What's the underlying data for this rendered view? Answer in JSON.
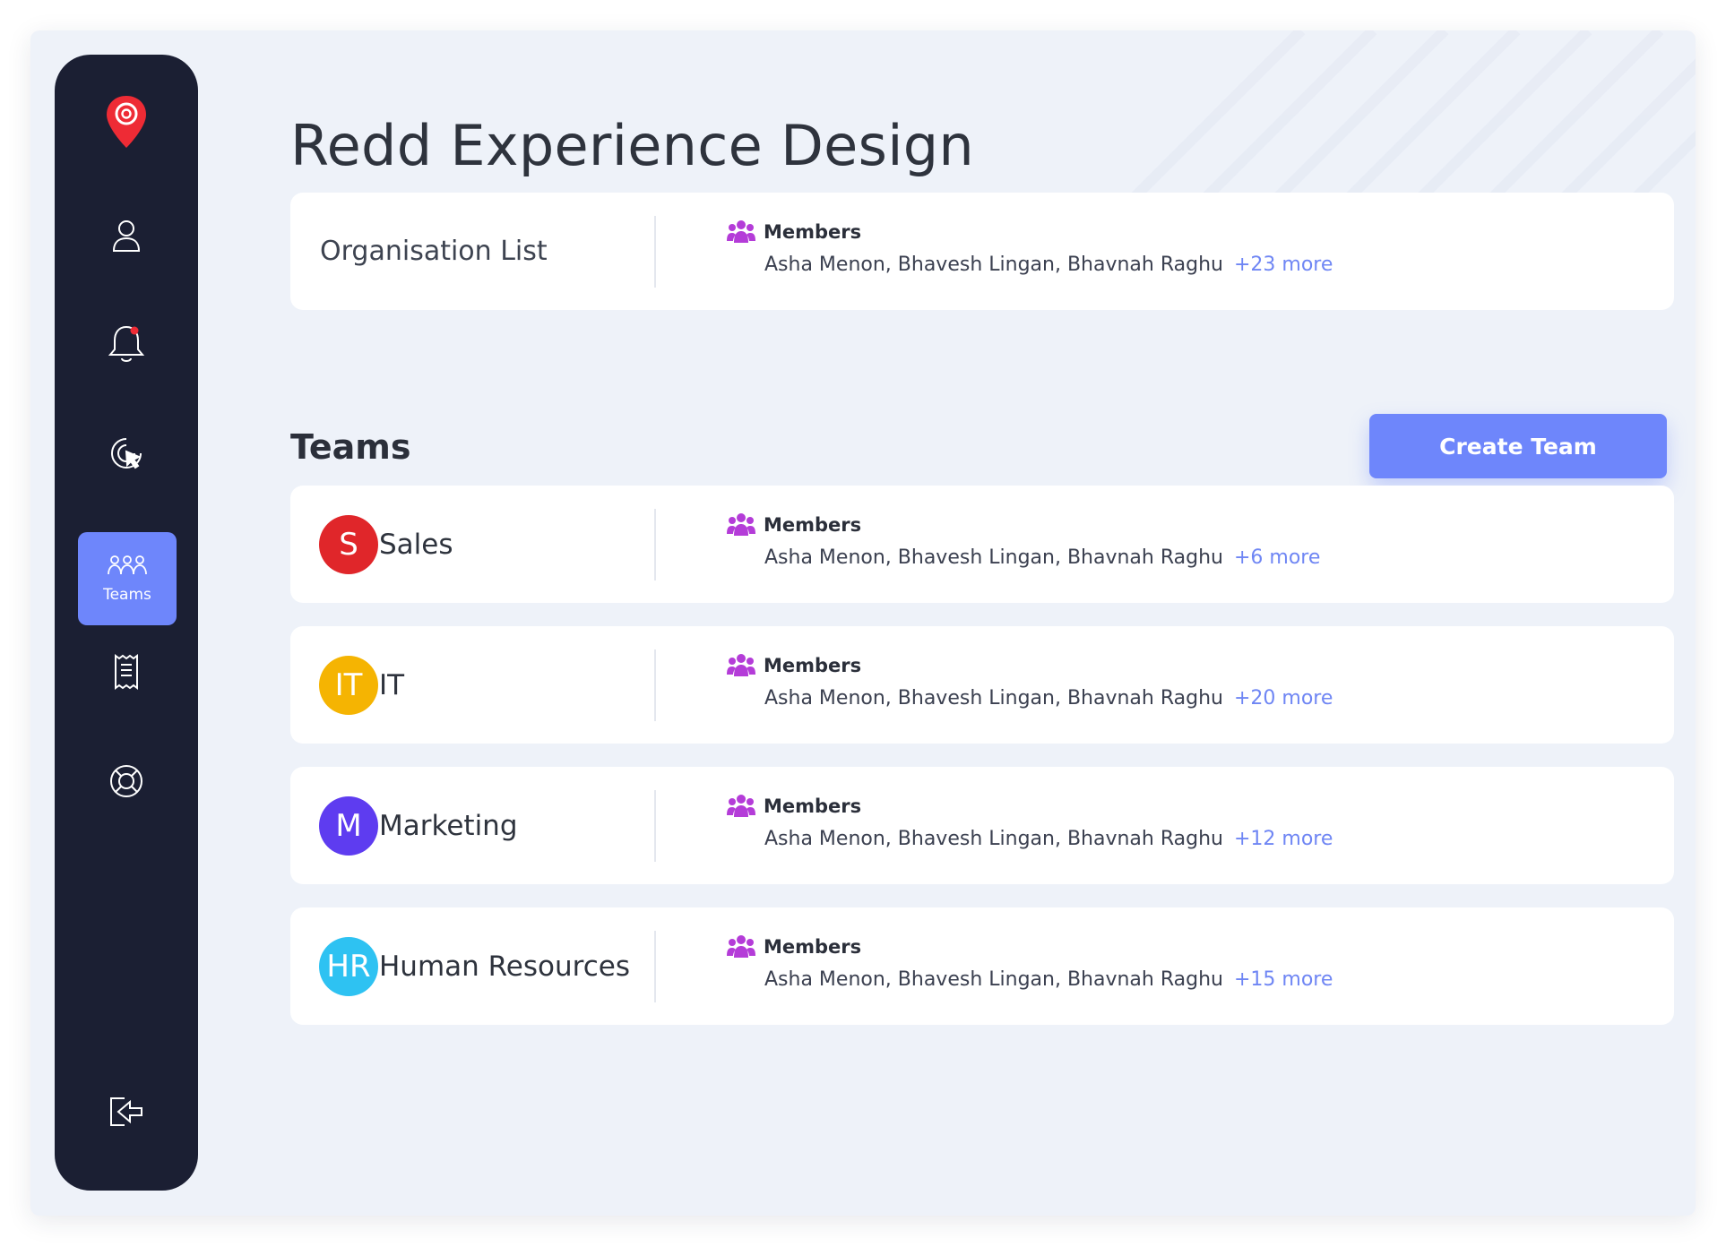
{
  "app": {
    "title": "Redd Experience Design"
  },
  "sidebar": {
    "items": [
      {
        "icon": "location-pin-logo"
      },
      {
        "icon": "user-icon"
      },
      {
        "icon": "bell-icon"
      },
      {
        "icon": "cursor-click-icon"
      },
      {
        "icon": "teams-icon",
        "label": "Teams",
        "active": true
      },
      {
        "icon": "receipt-icon"
      },
      {
        "icon": "lifebuoy-icon"
      },
      {
        "icon": "logout-icon"
      }
    ]
  },
  "organisation": {
    "label": "Organisation List",
    "members_label": "Members",
    "members": "Asha Menon, Bhavesh Lingan, Bhavnah Raghu",
    "more": "+23 more"
  },
  "teams": {
    "heading": "Teams",
    "create_label": "Create Team",
    "items": [
      {
        "initials": "S",
        "name": "Sales",
        "color": "#e0262a",
        "members_label": "Members",
        "members": "Asha Menon, Bhavesh Lingan, Bhavnah Raghu",
        "more": "+6 more"
      },
      {
        "initials": "IT",
        "name": "IT",
        "color": "#f5b402",
        "members_label": "Members",
        "members": "Asha Menon, Bhavesh Lingan, Bhavnah Raghu",
        "more": "+20 more"
      },
      {
        "initials": "M",
        "name": "Marketing",
        "color": "#5e3cf0",
        "members_label": "Members",
        "members": "Asha Menon, Bhavesh Lingan, Bhavnah Raghu",
        "more": "+12 more"
      },
      {
        "initials": "HR",
        "name": "Human Resources",
        "color": "#2ec2f2",
        "members_label": "Members",
        "members": "Asha Menon, Bhavesh Lingan, Bhavnah Raghu",
        "more": "+15 more"
      }
    ]
  },
  "colors": {
    "accent": "#6e86fb",
    "sidebar": "#1b1f33",
    "members_icon": "#b43cd8",
    "more_link": "#6f86f4"
  }
}
